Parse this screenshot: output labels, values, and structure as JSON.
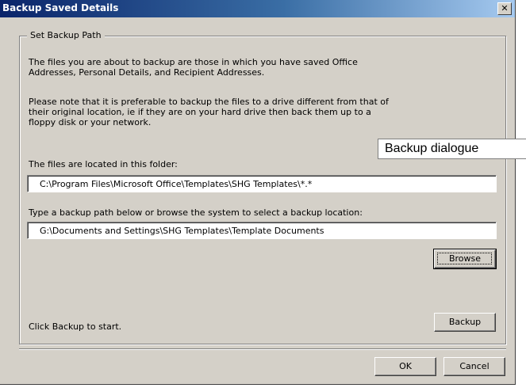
{
  "window": {
    "title": "Backup Saved Details",
    "close_glyph": "✕"
  },
  "group": {
    "legend": "Set Backup Path",
    "intro": "The files you are about to backup are those in which you have saved Office\nAddresses, Personal Details, and Recipient Addresses.",
    "note": "Please note that it is preferable to backup the files to a drive different from that of\ntheir original location, ie if they are on your hard drive then back them up to a\nfloppy disk or your network.",
    "source_label": "The files are located in this folder:",
    "source_value": "C:\\Program Files\\Microsoft Office\\Templates\\SHG Templates\\*.*",
    "dest_label": "Type a backup path below or browse the system to select a backup location:",
    "dest_value": "G:\\Documents and Settings\\SHG Templates\\Template Documents",
    "browse_label": "Browse",
    "status": "Click Backup to start.",
    "backup_label": "Backup"
  },
  "footer": {
    "ok_label": "OK",
    "cancel_label": "Cancel"
  },
  "callout": {
    "text": "Backup dialogue"
  }
}
